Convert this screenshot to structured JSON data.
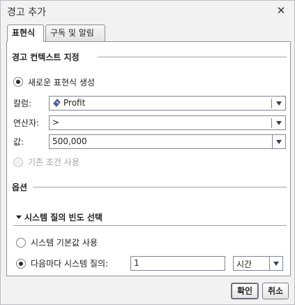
{
  "dialog": {
    "title": "경고 추가",
    "close_glyph": "✕"
  },
  "tabs": [
    {
      "label": "표현식",
      "selected": true
    },
    {
      "label": "구독 및 알림",
      "selected": false
    }
  ],
  "context_section": {
    "heading": "경고 컨텍스트 지정",
    "new_expression_label": "새로운 표현식 생성",
    "column": {
      "label": "칼럼:",
      "value": "Profit",
      "icon": "data-item-icon"
    },
    "operator": {
      "label": "연산자:",
      "value": ">"
    },
    "value": {
      "label": "값:",
      "value": "500,000"
    },
    "existing_condition_label": "기존 조건 사용"
  },
  "options_section": {
    "heading": "옵션",
    "frequency_heading": "시스템 질의 빈도 선택",
    "system_default_label": "시스템 기본값 사용",
    "every_label": "다음마다 시스템 질의:",
    "every_value": "1",
    "unit_value": "시간"
  },
  "buttons": {
    "ok": "확인",
    "cancel": "취소"
  },
  "colors": {
    "accent_line": "#9ba4b5",
    "panel_border": "#8e9196",
    "dialog_bg": "#f2f2f2"
  }
}
